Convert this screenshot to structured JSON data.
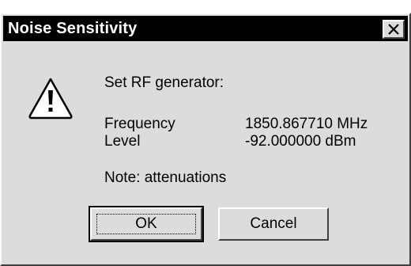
{
  "window": {
    "title": "Noise Sensitivity",
    "close_icon": "close-icon"
  },
  "message": {
    "icon": "warning-icon",
    "heading": "Set RF generator:",
    "rows": [
      {
        "label": "Frequency",
        "value": "1850.867710 MHz"
      },
      {
        "label": "Level",
        "value": "-92.000000 dBm"
      }
    ],
    "note": "Note: attenuations"
  },
  "buttons": {
    "ok": "OK",
    "cancel": "Cancel"
  }
}
